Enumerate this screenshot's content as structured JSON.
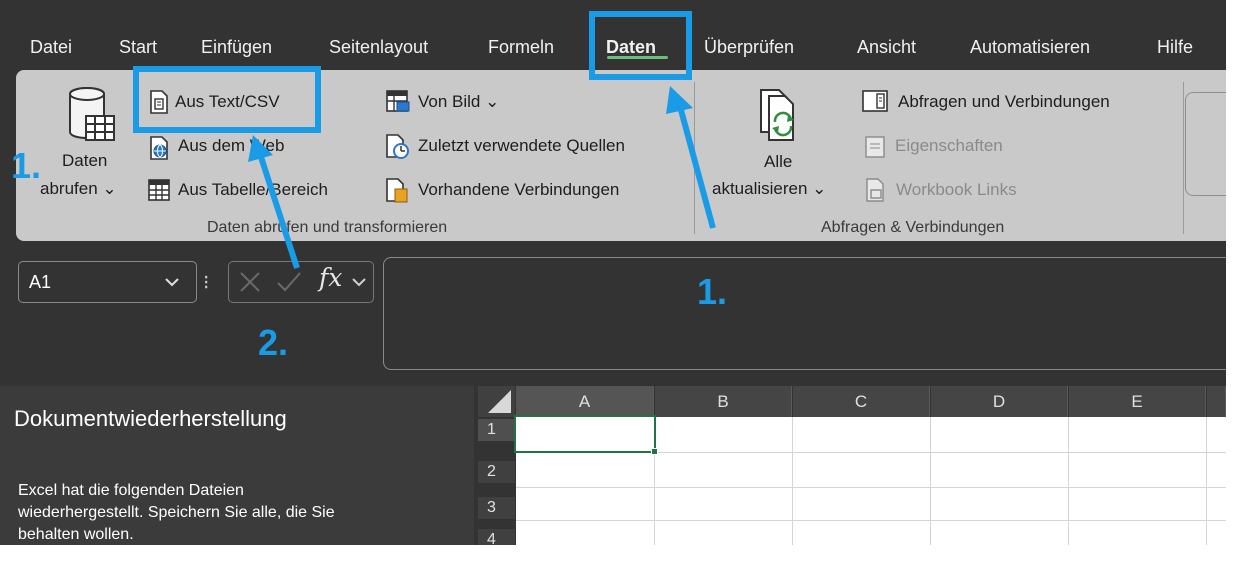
{
  "menu": {
    "tabs": [
      {
        "label": "Datei"
      },
      {
        "label": "Start"
      },
      {
        "label": "Einfügen"
      },
      {
        "label": "Seitenlayout"
      },
      {
        "label": "Formeln"
      },
      {
        "label": "Daten"
      },
      {
        "label": "Überprüfen"
      },
      {
        "label": "Ansicht"
      },
      {
        "label": "Automatisieren"
      },
      {
        "label": "Hilfe"
      }
    ],
    "active_tab": "Daten",
    "accent_color": "#6cbf7a"
  },
  "ribbon": {
    "get_data": {
      "line1": "Daten",
      "line2": "abrufen ⌄",
      "from_text_csv": "Aus Text/CSV",
      "from_web": "Aus dem Web",
      "from_table": "Aus Tabelle/Bereich",
      "from_picture": "Von Bild ⌄",
      "recent_sources": "Zuletzt verwendete Quellen",
      "existing_connections": "Vorhandene Verbindungen",
      "group_label": "Daten abrufen und transformieren"
    },
    "queries": {
      "refresh_line1": "Alle",
      "refresh_line2": "aktualisieren ⌄",
      "queries_connections": "Abfragen und Verbindungen",
      "properties": "Eigenschaften",
      "workbook_links": "Workbook Links",
      "group_label": "Abfragen & Verbindungen"
    }
  },
  "formula_bar": {
    "name_box": "A1",
    "fx_label": "fx",
    "value": ""
  },
  "recovery_pane": {
    "title": "Dokumentwiederherstellung",
    "lines": [
      "Excel hat die folgenden Dateien",
      "wiederhergestellt. Speichern Sie alle, die Sie",
      "behalten wollen."
    ]
  },
  "grid": {
    "columns": [
      "A",
      "B",
      "C",
      "D",
      "E"
    ],
    "rows": [
      "1",
      "2",
      "3",
      "4"
    ],
    "active_cell": "A1",
    "selection_color": "#217346"
  },
  "annotations": {
    "color": "#1a9be6",
    "label_1": "1.",
    "label_2": "2."
  }
}
